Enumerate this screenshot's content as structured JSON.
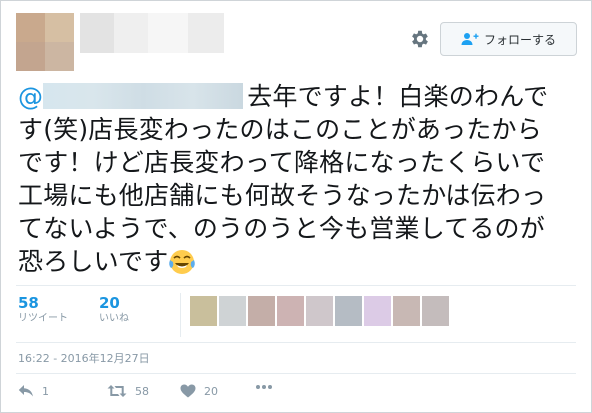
{
  "header": {
    "follow_label": "フォローする",
    "avatar_colors": [
      "#c9a98d",
      "#d6bfa3",
      "#c3a58f",
      "#ccb6a2"
    ],
    "name_blur_colors": [
      "#e3e3e3",
      "#efefef",
      "#f6f6f6",
      "#ececec"
    ]
  },
  "tweet": {
    "mention_prefix": "@",
    "lines": [
      "去年ですよ！白楽のわんで",
      "す(笑)店長変わったのはこのことがあったから",
      "です！けど店長変わって降格になったくらいで",
      "工場にも他店舗にも何故そうなったかは伝わっ",
      "てないようで、のうのうと今も営業してるのが",
      "恐ろしいです"
    ],
    "emoji": "face-with-tears-of-joy"
  },
  "stats": {
    "retweets": {
      "count": "58",
      "label": "リツイート"
    },
    "likes": {
      "count": "20",
      "label": "いいね"
    },
    "liker_avatar_colors": [
      "#c9bf9c",
      "#cfd3d5",
      "#c4aea8",
      "#cdb3b3",
      "#cfc7cb",
      "#b5bcc4",
      "#dccbe6",
      "#c8b8b4",
      "#c4bcbc"
    ]
  },
  "timestamp": "16:22 - 2016年12月27日",
  "actions": {
    "reply": "1",
    "retweet": "58",
    "like": "20"
  }
}
